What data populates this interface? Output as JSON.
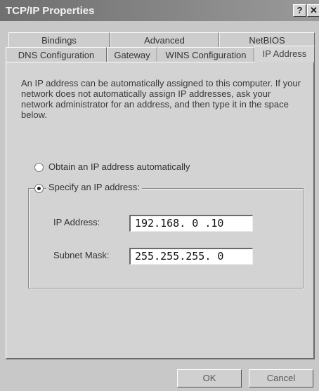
{
  "window": {
    "title": "TCP/IP Properties",
    "help_glyph": "?",
    "close_glyph": "✕"
  },
  "tabs": {
    "row_back": [
      "Bindings",
      "Advanced",
      "NetBIOS"
    ],
    "row_front": [
      "DNS Configuration",
      "Gateway",
      "WINS Configuration",
      "IP Address"
    ],
    "active": "IP Address"
  },
  "description": "An IP address can be automatically assigned to this computer. If your network does not automatically assign IP addresses, ask your network administrator for an address, and then type it in the space below.",
  "options": {
    "obtain_label": "Obtain an IP address automatically",
    "specify_label": "Specify an IP address:",
    "selected": "specify"
  },
  "fields": {
    "ip_label": "IP Address:",
    "ip_value": "192.168. 0 .10",
    "mask_label": "Subnet Mask:",
    "mask_value": "255.255.255. 0"
  },
  "buttons": {
    "ok": "OK",
    "cancel": "Cancel"
  },
  "colors": {
    "titlebar": "#808080",
    "dialog_bg": "#d3d3d3",
    "field_bg": "#ffffff"
  }
}
